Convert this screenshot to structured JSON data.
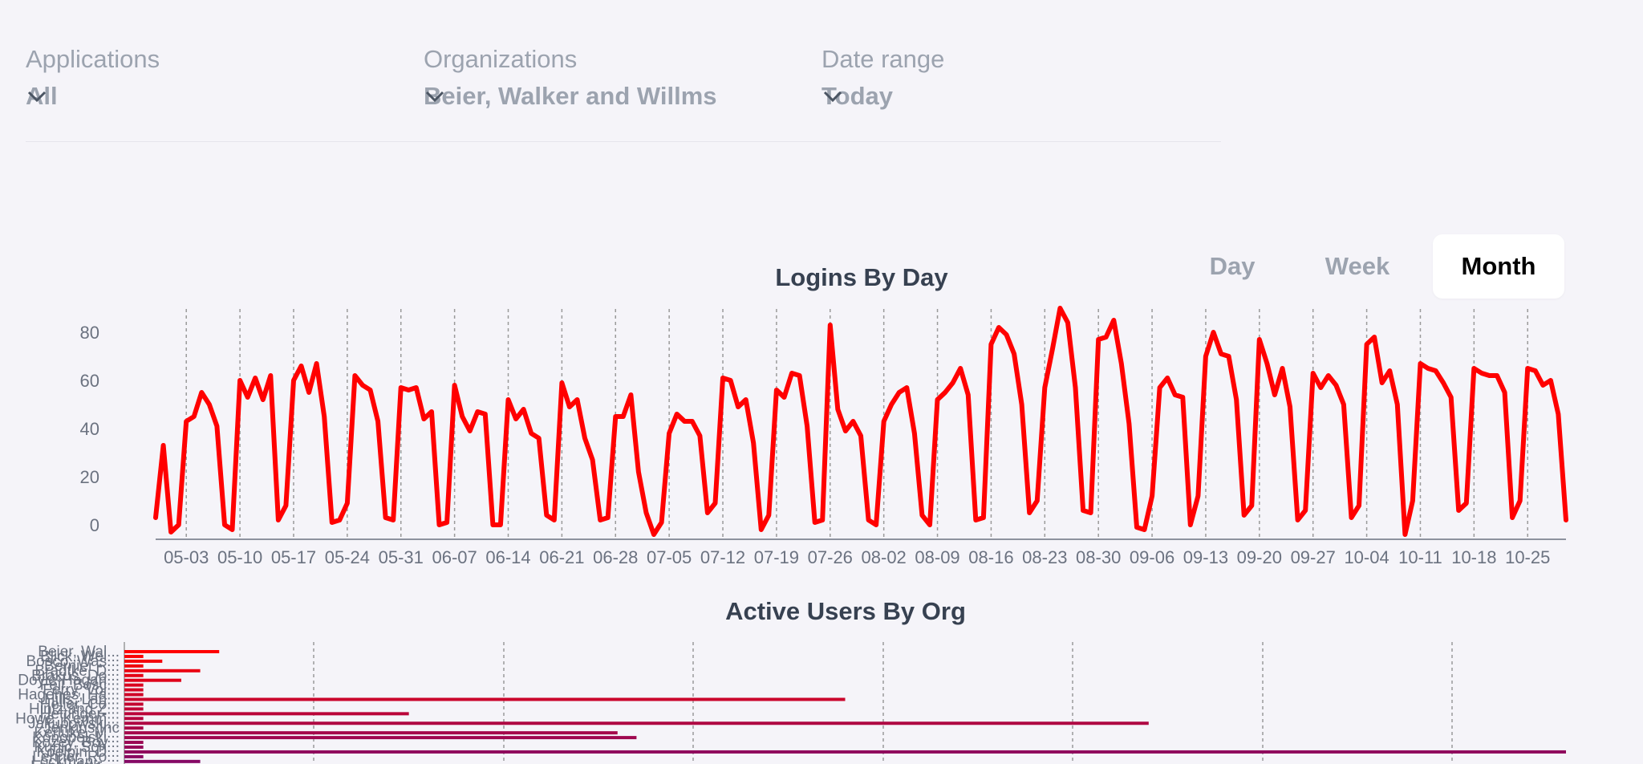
{
  "filters": {
    "applications": {
      "label": "Applications",
      "value": "All"
    },
    "organizations": {
      "label": "Organizations",
      "value": "Beier, Walker and Willms"
    },
    "date_range": {
      "label": "Date range",
      "value": "Today"
    }
  },
  "period_toggle": {
    "options": [
      "Day",
      "Week",
      "Month"
    ],
    "selected": "Month"
  },
  "icons": {
    "dropdown": "chevron-down-icon"
  },
  "colors": {
    "background": "#f5f4f9",
    "line": "#ff0000",
    "bar_start": "#ff0000",
    "bar_end": "#7a0a6e"
  },
  "chart_data": [
    {
      "type": "line",
      "title": "Logins By Day",
      "ylim": [
        -4,
        92
      ],
      "yticks": [
        0,
        20,
        40,
        60,
        80
      ],
      "grid": "vertical dashed",
      "xtick_labels": [
        "05-03",
        "05-10",
        "05-17",
        "05-24",
        "05-31",
        "06-07",
        "06-14",
        "06-21",
        "06-28",
        "07-05",
        "07-12",
        "07-19",
        "07-26",
        "08-02",
        "08-09",
        "08-16",
        "08-23",
        "08-30",
        "09-06",
        "09-13",
        "09-20",
        "09-27",
        "10-04",
        "10-11",
        "10-18",
        "10-25"
      ],
      "series": [
        {
          "start_date": "04-29",
          "values": [
            3,
            33,
            -3,
            0,
            43,
            45,
            55,
            50,
            41,
            0,
            -2,
            60,
            53,
            61,
            52,
            62,
            2,
            8,
            60,
            66,
            55,
            67,
            45,
            1,
            2,
            9,
            62,
            58,
            56,
            43,
            3,
            2,
            57,
            56,
            57,
            44,
            47,
            0,
            1,
            58,
            45,
            39,
            47,
            46,
            0,
            0,
            52,
            44,
            48,
            38,
            36,
            4,
            2,
            59,
            49,
            52,
            36,
            27,
            2,
            3,
            45,
            45,
            54,
            22,
            5,
            -4,
            1,
            38,
            46,
            43,
            43,
            37,
            5,
            9,
            61,
            60,
            49,
            52,
            34,
            -2,
            4,
            56,
            53,
            63,
            62,
            41,
            1,
            2,
            83,
            48,
            39,
            43,
            37,
            2,
            0,
            43,
            50,
            55,
            57,
            38,
            4,
            0,
            52,
            55,
            59,
            65,
            54,
            2,
            3,
            75,
            82,
            79,
            71,
            50,
            5,
            10,
            57,
            73,
            90,
            84,
            57,
            6,
            5,
            77,
            78,
            85,
            67,
            42,
            -1,
            -2,
            12,
            57,
            61,
            54,
            53,
            0,
            12,
            70,
            80,
            71,
            70,
            52,
            4,
            8,
            77,
            67,
            54,
            65,
            49,
            2,
            6,
            63,
            57,
            62,
            58,
            50,
            3,
            8,
            75,
            78,
            59,
            64,
            50,
            -4,
            10,
            67,
            65,
            64,
            59,
            53,
            6,
            9,
            65,
            63,
            62,
            62,
            55,
            3,
            10,
            65,
            64,
            58,
            60,
            46,
            2
          ]
        }
      ]
    },
    {
      "type": "bar",
      "orientation": "horizontal",
      "title": "Active Users By Org",
      "grid": "vertical dashed",
      "categories": [
        "Beier, Wal...",
        "Blick, Wel...",
        "Bosco, Was...",
        "Bernier - ...",
        "Bradtke, D...",
        "Brakus, Do...",
        "Doyle-Hagan...",
        "Feil, Bosc...",
        "Ferry, Vol...",
        "Hagenes, Ha...",
        "Hills, Lan...",
        "Heller, Co...",
        "Hintz and Z...",
        "Hettinger-...",
        "Howe, Kemm...",
        "Jakubowski...",
        "Jenkins Inc",
        "Kerluke, M...",
        "Konopelski...",
        "Kozey, Boy...",
        "Kuhic, Sch...",
        "Koelpin, D...",
        "Lehner, Ro...",
        "Lockman - ...",
        "Langworth-...",
        "Marvin and ..."
      ],
      "values": [
        100,
        20,
        40,
        20,
        80,
        20,
        60,
        20,
        20,
        20,
        760,
        20,
        20,
        300,
        20,
        1080,
        20,
        520,
        540,
        20,
        20,
        1520,
        20,
        80,
        60,
        20
      ],
      "xlim": [
        0,
        1520
      ]
    }
  ]
}
